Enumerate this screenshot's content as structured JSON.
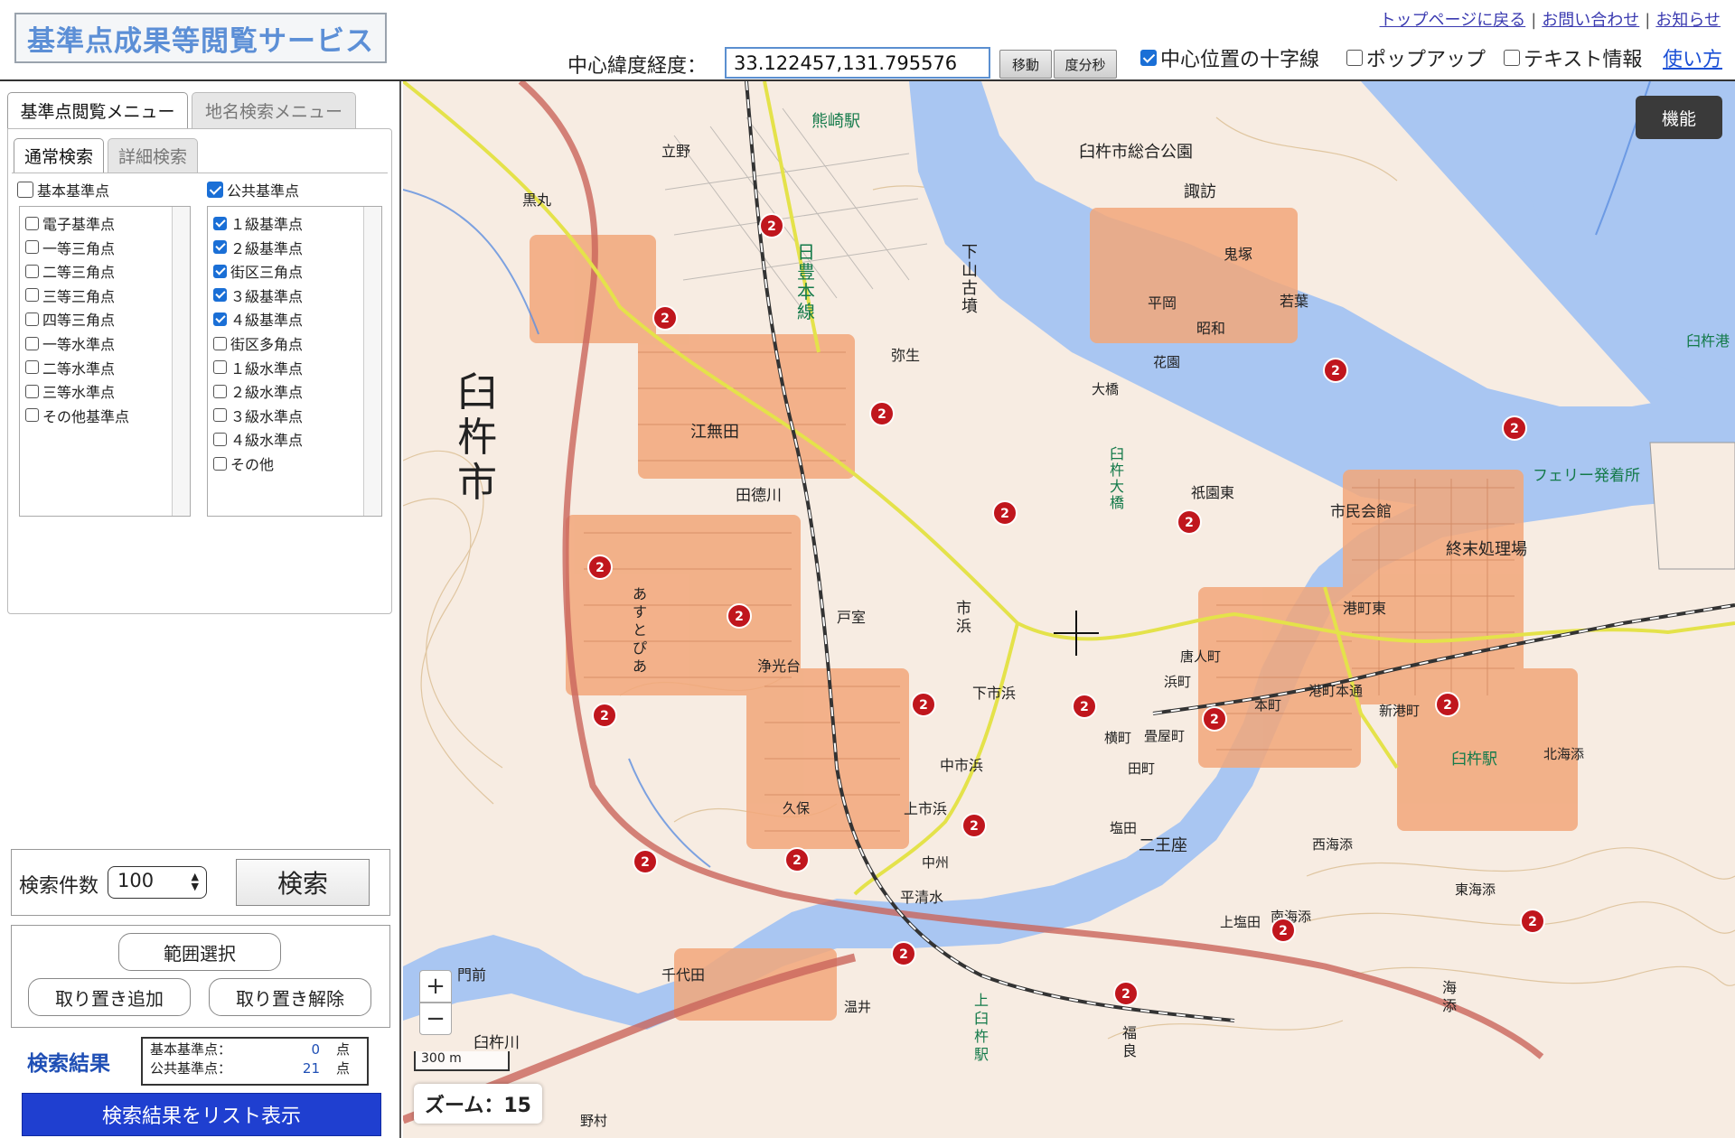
{
  "header": {
    "title": "基準点成果等閲覧サービス",
    "links": [
      "トップページに戻る",
      "お問い合わせ",
      "お知らせ"
    ],
    "coord_label": "中心緯度経度：",
    "coord_value": "33.122457,131.795576",
    "move_button": "移動",
    "dms_button": "度分秒",
    "crosshair_label": "中心位置の十字線",
    "crosshair_checked": true,
    "popup_label": "ポップアップ",
    "popup_checked": false,
    "text_info_label": "テキスト情報",
    "text_info_checked": false,
    "help_link": "使い方"
  },
  "left_panel": {
    "tabs": [
      "基準点閲覧メニュー",
      "地名検索メニュー"
    ],
    "sub_tabs": [
      "通常検索",
      "詳細検索"
    ],
    "basic_group": {
      "label": "基本基準点",
      "checked": false,
      "items": [
        {
          "label": "電子基準点",
          "checked": false
        },
        {
          "label": "一等三角点",
          "checked": false
        },
        {
          "label": "二等三角点",
          "checked": false
        },
        {
          "label": "三等三角点",
          "checked": false
        },
        {
          "label": "四等三角点",
          "checked": false
        },
        {
          "label": "一等水準点",
          "checked": false
        },
        {
          "label": "二等水準点",
          "checked": false
        },
        {
          "label": "三等水準点",
          "checked": false
        },
        {
          "label": "その他基準点",
          "checked": false
        }
      ]
    },
    "public_group": {
      "label": "公共基準点",
      "checked": true,
      "items": [
        {
          "label": "１級基準点",
          "checked": true
        },
        {
          "label": "２級基準点",
          "checked": true
        },
        {
          "label": "街区三角点",
          "checked": true
        },
        {
          "label": "３級基準点",
          "checked": true
        },
        {
          "label": "４級基準点",
          "checked": true
        },
        {
          "label": "街区多角点",
          "checked": false
        },
        {
          "label": "１級水準点",
          "checked": false
        },
        {
          "label": "２級水準点",
          "checked": false
        },
        {
          "label": "３級水準点",
          "checked": false
        },
        {
          "label": "４級水準点",
          "checked": false
        },
        {
          "label": "その他",
          "checked": false
        }
      ]
    },
    "search_count_label": "検索件数",
    "search_count_value": "100",
    "search_button": "検索",
    "range_select_button": "範囲選択",
    "keep_add_button": "取り置き追加",
    "keep_remove_button": "取り置き解除",
    "result_title": "検索結果",
    "result_basic_label": "基本基準点：",
    "result_basic_count": "0",
    "result_public_label": "公共基準点：",
    "result_public_count": "21",
    "result_unit": "点",
    "list_display_button": "検索結果をリスト表示"
  },
  "map": {
    "function_button": "機能",
    "zoom_in": "+",
    "zoom_out": "−",
    "scale_label": "300 m",
    "zoom_label": "ズーム：15",
    "marker_label": "2",
    "marker_color": "#c0161d",
    "sea_color": "#a9c6f2",
    "labels": [
      "臼杵市",
      "熊崎駅",
      "臼杵市総合公園",
      "諏訪",
      "日豊本線",
      "下山古墳",
      "江無田",
      "田德川",
      "臼杵大橋",
      "祇園東",
      "市民会館",
      "フェリー発着所",
      "終末処理場",
      "臼杵駅",
      "港町東",
      "市浜",
      "浄光台",
      "下市浜",
      "中市浜",
      "上市浜",
      "平清水",
      "二王座",
      "南海添",
      "東海添",
      "海添",
      "上臼杵駅",
      "臼杵川",
      "千代田",
      "門前",
      "福良",
      "立野",
      "黒丸",
      "あすとぴあ",
      "久保",
      "戸室",
      "弥生",
      "昭和",
      "若葉",
      "鬼塚",
      "平岡",
      "花園",
      "大橋",
      "北海添",
      "西海添",
      "港町本通",
      "新港町",
      "本町",
      "唐人町",
      "浜町",
      "横町",
      "畳屋町",
      "田町",
      "塩田",
      "上塩田",
      "中州",
      "温井",
      "野村",
      "臼杵港"
    ]
  }
}
